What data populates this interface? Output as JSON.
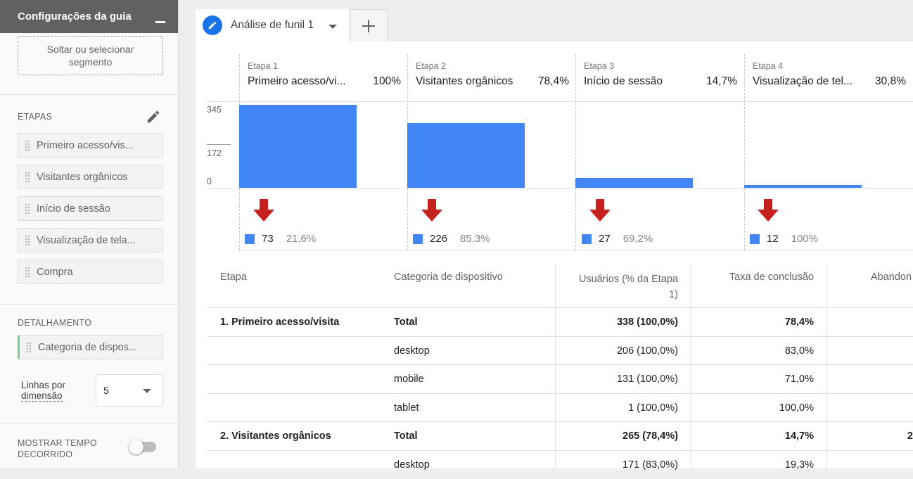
{
  "sidebar": {
    "title": "Configurações da guia",
    "segment_drop": "Soltar ou selecionar segmento",
    "steps_label": "ETAPAS",
    "steps": [
      {
        "label": "Primeiro acesso/vis..."
      },
      {
        "label": "Visitantes orgânicos"
      },
      {
        "label": "Início de sessão"
      },
      {
        "label": "Visualização de tela..."
      },
      {
        "label": "Compra"
      }
    ],
    "breakdown_label": "DETALHAMENTO",
    "breakdown_value": "Categoria de dispos...",
    "rows_label_1": "Linhas por",
    "rows_label_2": "dimensão",
    "rows_value": "5",
    "elapsed_label_1": "MOSTRAR TEMPO",
    "elapsed_label_2": "DECORRIDO"
  },
  "tabs": {
    "active": "Análise de funil 1"
  },
  "funnel": {
    "y_ticks": [
      "345",
      "172",
      "0"
    ],
    "steps": [
      {
        "name": "Etapa 1",
        "title": "Primeiro acesso/vi...",
        "pct": "100%",
        "drop_count": "73",
        "drop_pct": "21,6%"
      },
      {
        "name": "Etapa 2",
        "title": "Visitantes orgânicos",
        "pct": "78,4%",
        "drop_count": "226",
        "drop_pct": "85,3%"
      },
      {
        "name": "Etapa 3",
        "title": "Início de sessão",
        "pct": "14,7%",
        "drop_count": "27",
        "drop_pct": "69,2%"
      },
      {
        "name": "Etapa 4",
        "title": "Visualização de tel...",
        "pct": "30,8%",
        "drop_count": "12",
        "drop_pct": "100%"
      }
    ]
  },
  "chart_data": {
    "type": "bar",
    "categories": [
      "Etapa 1",
      "Etapa 2",
      "Etapa 3",
      "Etapa 4"
    ],
    "values": [
      338,
      265,
      39,
      12
    ],
    "ylim": [
      0,
      345
    ],
    "yticks": [
      0,
      172,
      345
    ]
  },
  "table": {
    "headers": {
      "step": "Etapa",
      "device": "Categoria de dispositivo",
      "users_1": "Usuários (% da Etapa",
      "users_2": "1)",
      "completion": "Taxa de conclusão",
      "abandon": "Abandon"
    },
    "rows": [
      {
        "step": "1. Primeiro acesso/visita",
        "device": "Total",
        "users": "338 (100,0%)",
        "completion": "78,4%",
        "abandon": ""
      },
      {
        "step": "",
        "device": "desktop",
        "users": "206 (100,0%)",
        "completion": "83,0%",
        "abandon": ""
      },
      {
        "step": "",
        "device": "mobile",
        "users": "131 (100,0%)",
        "completion": "71,0%",
        "abandon": ""
      },
      {
        "step": "",
        "device": "tablet",
        "users": "1 (100,0%)",
        "completion": "100,0%",
        "abandon": ""
      },
      {
        "step": "2. Visitantes orgânicos",
        "device": "Total",
        "users": "265 (78,4%)",
        "completion": "14,7%",
        "abandon": "2"
      },
      {
        "step": "",
        "device": "desktop",
        "users": "171 (83,0%)",
        "completion": "19,3%",
        "abandon": ""
      }
    ]
  }
}
